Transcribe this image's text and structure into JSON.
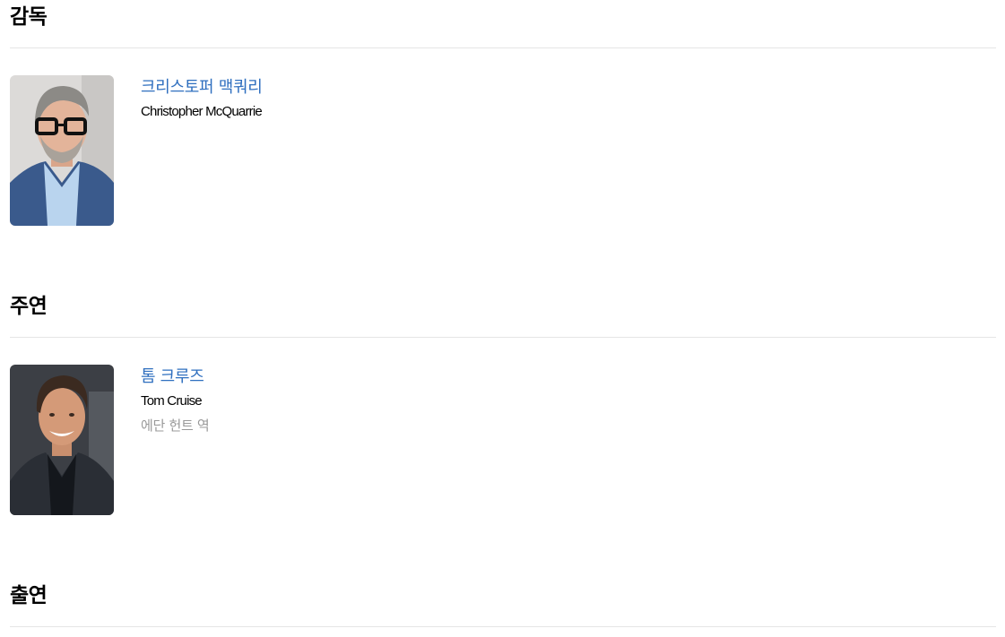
{
  "sections": [
    {
      "title": "감독",
      "people": [
        {
          "name_ko": "크리스토퍼 맥쿼리",
          "name_en": "Christopher McQuarrie",
          "role": ""
        }
      ]
    },
    {
      "title": "주연",
      "people": [
        {
          "name_ko": "톰 크루즈",
          "name_en": "Tom Cruise",
          "role": "에단 헌트 역"
        }
      ]
    },
    {
      "title": "출연",
      "people": []
    }
  ],
  "colors": {
    "link": "#2f6fbf",
    "role": "#999999",
    "divider": "#e5e5e5"
  }
}
